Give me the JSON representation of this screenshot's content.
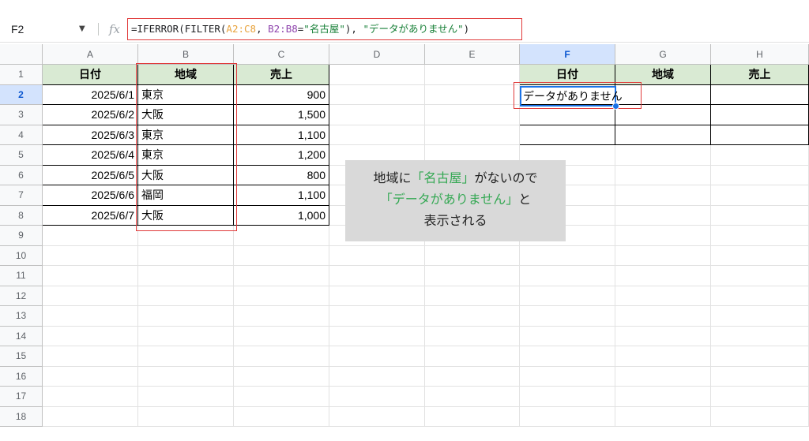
{
  "name_box": "F2",
  "formula": {
    "prefix": "=IFERROR(FILTER(",
    "ref1": "A2:C8",
    "sep1": ", ",
    "ref2": "B2:B8",
    "eq": "=",
    "str1": "\"名古屋\"",
    "sep2": "), ",
    "str2": "\"データがありません\"",
    "suffix": ")"
  },
  "columns": [
    "A",
    "B",
    "C",
    "D",
    "E",
    "F",
    "G",
    "H"
  ],
  "rows": [
    "1",
    "2",
    "3",
    "4",
    "5",
    "6",
    "7",
    "8",
    "9",
    "10",
    "11",
    "12",
    "13",
    "14",
    "15",
    "16",
    "17",
    "18"
  ],
  "source_table": {
    "headers": [
      "日付",
      "地域",
      "売上"
    ],
    "rows": [
      [
        "2025/6/1",
        "東京",
        "900"
      ],
      [
        "2025/6/2",
        "大阪",
        "1,500"
      ],
      [
        "2025/6/3",
        "東京",
        "1,100"
      ],
      [
        "2025/6/4",
        "東京",
        "1,200"
      ],
      [
        "2025/6/5",
        "大阪",
        "800"
      ],
      [
        "2025/6/6",
        "福岡",
        "1,100"
      ],
      [
        "2025/6/7",
        "大阪",
        "1,000"
      ]
    ]
  },
  "result_table": {
    "headers": [
      "日付",
      "地域",
      "売上"
    ],
    "result_text": "データがありません"
  },
  "note": {
    "line1_a": "地域に",
    "line1_b": "「名古屋」",
    "line1_c": "がないので",
    "line2_a": "「データがありません」",
    "line2_b": "と",
    "line3": "表示される"
  },
  "colors": {
    "header_fill": "#d9ead3",
    "highlight": "#e03a3a",
    "selection": "#1a73e8",
    "note_bg": "#d9d9d9",
    "note_accent": "#34a853"
  }
}
